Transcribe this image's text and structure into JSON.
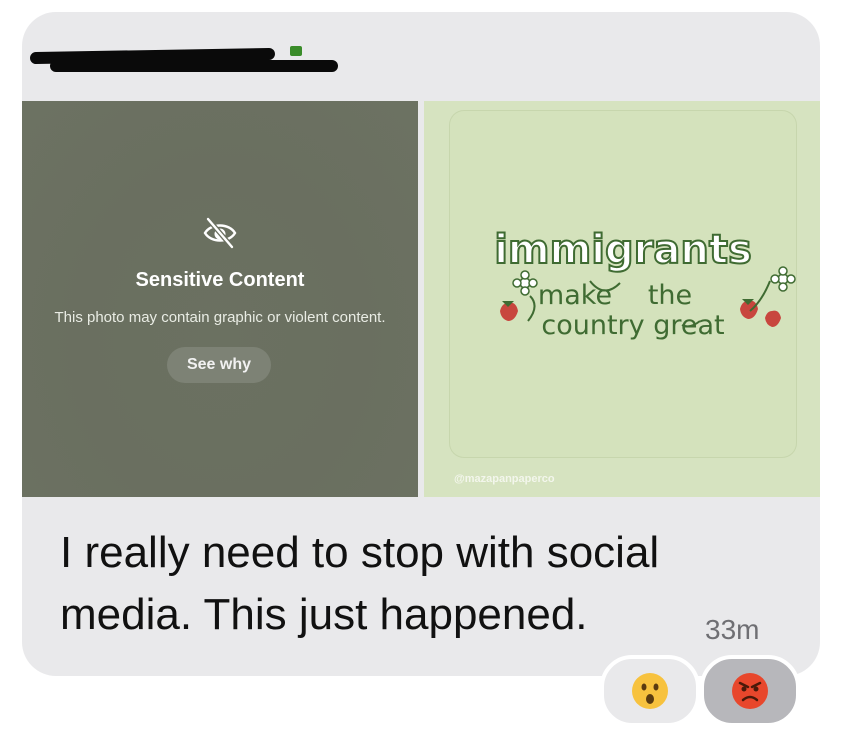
{
  "sensitive": {
    "title": "Sensitive Content",
    "subtitle": "This photo may contain graphic or violent content.",
    "button": "See why",
    "icon": "eye-slash-icon"
  },
  "artwork": {
    "line1": "immigrants",
    "line2a": "make",
    "line2b": "the",
    "line3": "country great",
    "watermark": "@mazapanpaperco",
    "colors": {
      "background": "#d6e3c0",
      "text": "#3f6b32"
    }
  },
  "message": {
    "line1": "I really need to stop with social",
    "line2": "media. This just happened.",
    "time": "33m"
  },
  "reactions": [
    {
      "emoji": "😮",
      "icon": "surprised-face-icon"
    },
    {
      "emoji": "😡",
      "icon": "angry-face-icon"
    }
  ]
}
